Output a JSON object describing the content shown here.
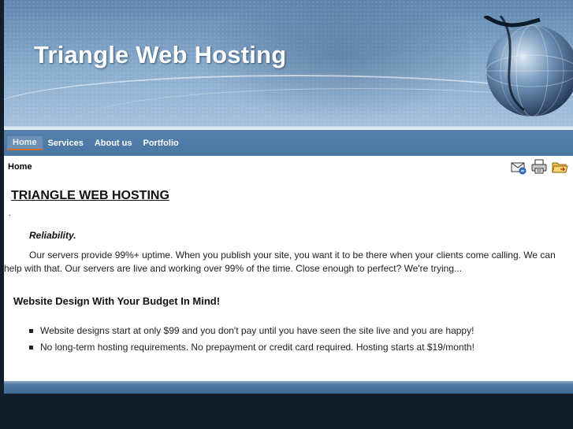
{
  "header": {
    "title": "Triangle Web Hosting"
  },
  "nav": {
    "items": [
      "Home",
      "Services",
      "About us",
      "Portfolio"
    ],
    "active": "Home"
  },
  "breadcrumb": "Home",
  "toolbar": {
    "icons": [
      "email-icon",
      "print-icon",
      "folder-icon"
    ]
  },
  "content": {
    "heading": "TRIANGLE WEB HOSTING",
    "dot": ".",
    "reliability": {
      "title": "Reliability.",
      "text_line1": "Our servers provide 99%+ uptime.  When you publish your site, you want it to be there when your clients come calling.  We can",
      "text_line2": "help with that.  Our servers are live and working over 99% of the time.  Close enough to perfect?  We're trying..."
    },
    "section2": {
      "title": "Website Design With Your Budget In Mind!",
      "bullets": [
        "Website designs start at only $99 and you don't pay until you have seen the site live and you are happy!",
        "No long-term hosting requirements.  No prepayment or credit card required.  Hosting starts at $19/month!"
      ]
    }
  },
  "colors": {
    "nav": "#4a77a3",
    "background": "#111d28",
    "active_underline": "#d36a2a"
  }
}
